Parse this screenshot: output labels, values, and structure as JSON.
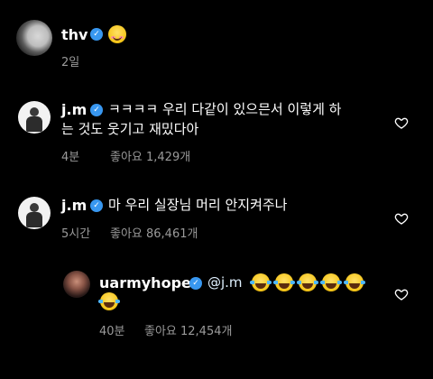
{
  "post": {
    "username": "thv",
    "verified_mark": "✓",
    "caption_emoji": "smiling-face",
    "time_ago": "2일"
  },
  "comments": [
    {
      "username": "j.m",
      "verified_mark": "✓",
      "line1": "ㅋㅋㅋㅋ 우리 다같이 있으믄서 이렇게 하",
      "line2": "는 것도 웃기고 재밌다아",
      "time_ago": "4분",
      "likes": "좋아요 1,429개"
    },
    {
      "username": "j.m",
      "verified_mark": "✓",
      "line1": "마 우리 실장님 머리 안지켜주나",
      "time_ago": "5시간",
      "likes": "좋아요 86,461개"
    }
  ],
  "reply": {
    "username": "uarmyhope",
    "verified_mark": "✓",
    "mention": "@j.m",
    "emoji": "face-with-tears-of-joy",
    "emoji_count": 6,
    "time_ago": "40분",
    "likes": "좋아요 12,454개"
  },
  "icons": {
    "like": "heart-outline-icon"
  }
}
